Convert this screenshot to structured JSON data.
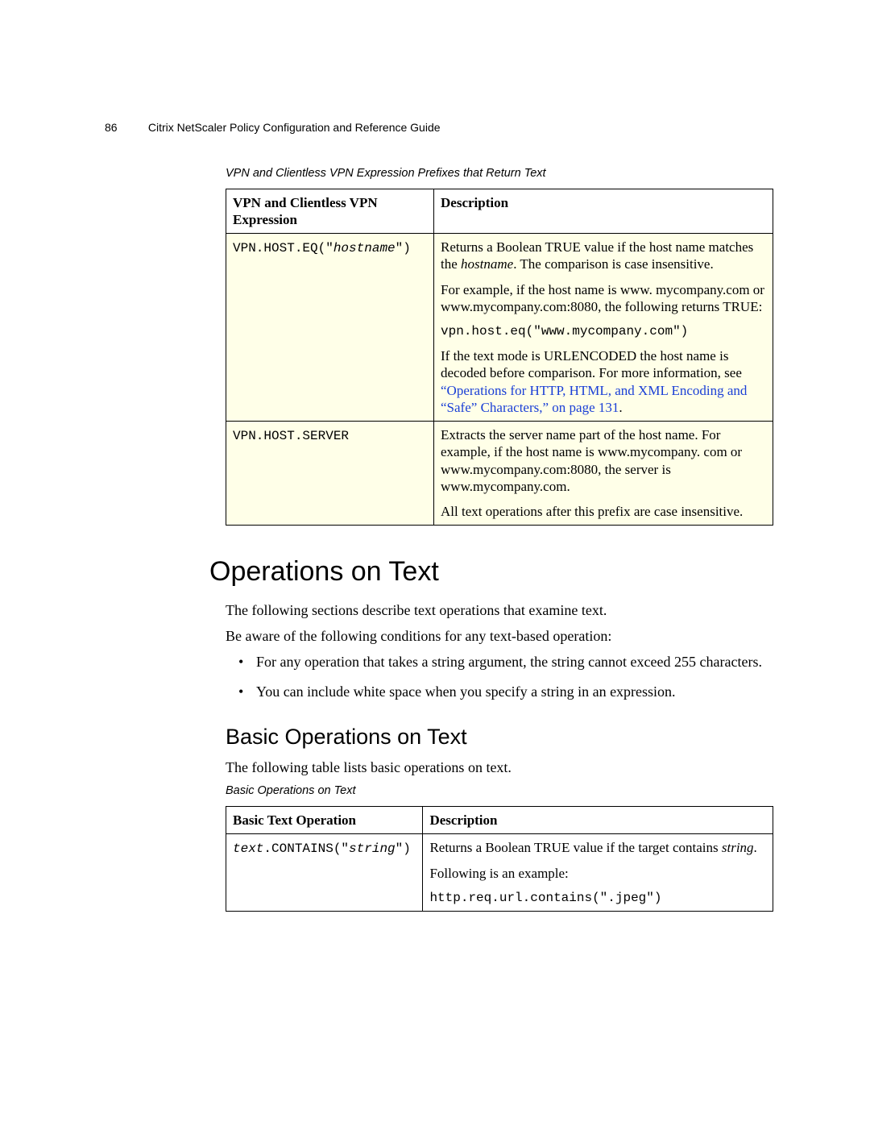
{
  "header": {
    "page_number": "86",
    "title": "Citrix NetScaler Policy Configuration and Reference Guide"
  },
  "table1": {
    "caption": "VPN and Clientless VPN Expression Prefixes that Return Text",
    "col1_header": "VPN and Clientless VPN Expression",
    "col2_header": "Description",
    "rows": [
      {
        "expr_prefix": "VPN.HOST.EQ(\"",
        "expr_arg": "hostname",
        "expr_suffix": "\")",
        "desc_p1_a": "Returns a Boolean TRUE value if the host name matches the ",
        "desc_p1_b": "hostname",
        "desc_p1_c": ". The comparison is case insensitive.",
        "desc_p2": "For example, if the host name is www. mycompany.com or www.mycompany.com:8080, the following returns TRUE:",
        "desc_code": "vpn.host.eq(\"www.mycompany.com\")",
        "desc_p3_a": "If the text mode is URLENCODED the host name is decoded before comparison. For more information, see ",
        "desc_p3_link": "“Operations for HTTP, HTML, and XML Encoding and “Safe” Characters,” on page 131",
        "desc_p3_c": "."
      },
      {
        "expr": "VPN.HOST.SERVER",
        "desc_p1": "Extracts the server name part of the host name. For example, if the host name is www.mycompany. com or www.mycompany.com:8080, the server is www.mycompany.com.",
        "desc_p2": "All text operations after this prefix are case insensitive."
      }
    ]
  },
  "section": {
    "h1": "Operations on Text",
    "p1": "The following sections describe text operations that examine text.",
    "p2": "Be aware of the following conditions for any text-based operation:",
    "b1": "For any operation that takes a string argument, the string cannot exceed 255 characters.",
    "b2": "You can include white space when you specify a string in an expression."
  },
  "sub": {
    "h2": "Basic Operations on Text",
    "p1": "The following table lists basic operations on text."
  },
  "table2": {
    "caption": "Basic Operations on Text",
    "col1_header": "Basic Text Operation",
    "col2_header": "Description",
    "row": {
      "expr_prefix": "text",
      "expr_mid": ".CONTAINS(\"",
      "expr_arg": "string",
      "expr_suffix": "\")",
      "desc_p1_a": "Returns a Boolean TRUE value if the target contains ",
      "desc_p1_b": "string",
      "desc_p1_c": ".",
      "desc_p2": "Following is an example:",
      "desc_code": "http.req.url.contains(\".jpeg\")"
    }
  }
}
